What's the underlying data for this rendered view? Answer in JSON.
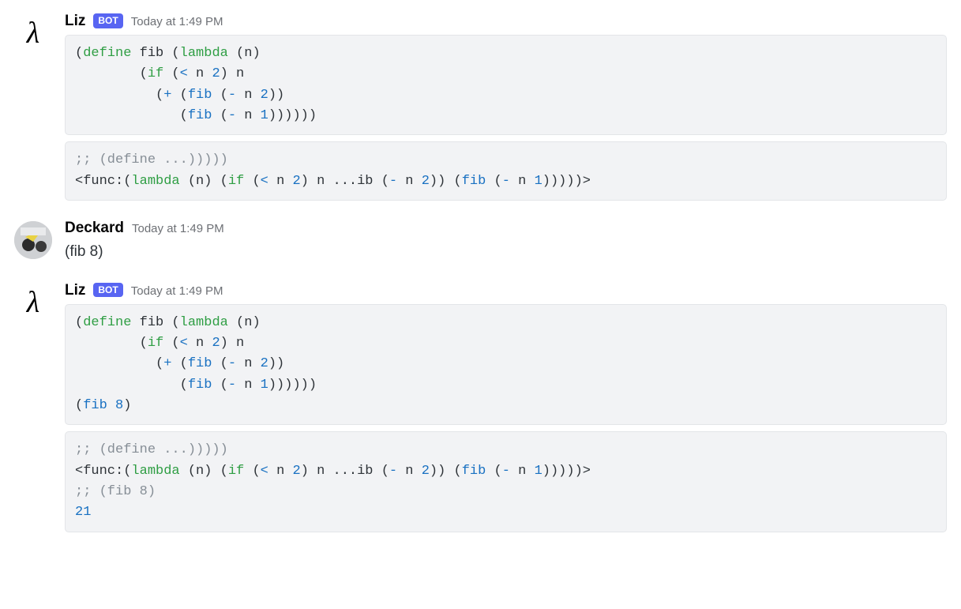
{
  "messages": [
    {
      "author": "Liz",
      "is_bot": true,
      "bot_label": "BOT",
      "timestamp": "Today at 1:49 PM",
      "avatar": {
        "type": "lambda",
        "glyph": "λ"
      },
      "blocks": [
        {
          "kind": "code",
          "lines": [
            [
              [
                "txt",
                "("
              ],
              [
                "kw",
                "define"
              ],
              [
                "txt",
                " fib ("
              ],
              [
                "kw",
                "lambda"
              ],
              [
                "txt",
                " (n)"
              ]
            ],
            [
              [
                "txt",
                "        ("
              ],
              [
                "kw",
                "if"
              ],
              [
                "txt",
                " ("
              ],
              [
                "fn",
                "<"
              ],
              [
                "txt",
                " n "
              ],
              [
                "num",
                "2"
              ],
              [
                "txt",
                ") n"
              ]
            ],
            [
              [
                "txt",
                "          ("
              ],
              [
                "fn",
                "+"
              ],
              [
                "txt",
                " ("
              ],
              [
                "fn",
                "fib"
              ],
              [
                "txt",
                " ("
              ],
              [
                "fn",
                "-"
              ],
              [
                "txt",
                " n "
              ],
              [
                "num",
                "2"
              ],
              [
                "txt",
                "))"
              ]
            ],
            [
              [
                "txt",
                "             ("
              ],
              [
                "fn",
                "fib"
              ],
              [
                "txt",
                " ("
              ],
              [
                "fn",
                "-"
              ],
              [
                "txt",
                " n "
              ],
              [
                "num",
                "1"
              ],
              [
                "txt",
                "))))))"
              ]
            ]
          ]
        },
        {
          "kind": "code",
          "lines": [
            [
              [
                "cm",
                ";; (define ...)))))"
              ]
            ],
            [
              [
                "txt",
                "<func:("
              ],
              [
                "kw",
                "lambda"
              ],
              [
                "txt",
                " (n) ("
              ],
              [
                "kw",
                "if"
              ],
              [
                "txt",
                " ("
              ],
              [
                "fn",
                "<"
              ],
              [
                "txt",
                " n "
              ],
              [
                "num",
                "2"
              ],
              [
                "txt",
                ") n ...ib ("
              ],
              [
                "fn",
                "-"
              ],
              [
                "txt",
                " n "
              ],
              [
                "num",
                "2"
              ],
              [
                "txt",
                ")) ("
              ],
              [
                "fn",
                "fib"
              ],
              [
                "txt",
                " ("
              ],
              [
                "fn",
                "-"
              ],
              [
                "txt",
                " n "
              ],
              [
                "num",
                "1"
              ],
              [
                "txt",
                ")))))>"
              ]
            ]
          ]
        }
      ]
    },
    {
      "author": "Deckard",
      "is_bot": false,
      "timestamp": "Today at 1:49 PM",
      "avatar": {
        "type": "user"
      },
      "blocks": [
        {
          "kind": "text",
          "text": "(fib 8)"
        }
      ]
    },
    {
      "author": "Liz",
      "is_bot": true,
      "bot_label": "BOT",
      "timestamp": "Today at 1:49 PM",
      "avatar": {
        "type": "lambda",
        "glyph": "λ"
      },
      "blocks": [
        {
          "kind": "code",
          "lines": [
            [
              [
                "txt",
                "("
              ],
              [
                "kw",
                "define"
              ],
              [
                "txt",
                " fib ("
              ],
              [
                "kw",
                "lambda"
              ],
              [
                "txt",
                " (n)"
              ]
            ],
            [
              [
                "txt",
                "        ("
              ],
              [
                "kw",
                "if"
              ],
              [
                "txt",
                " ("
              ],
              [
                "fn",
                "<"
              ],
              [
                "txt",
                " n "
              ],
              [
                "num",
                "2"
              ],
              [
                "txt",
                ") n"
              ]
            ],
            [
              [
                "txt",
                "          ("
              ],
              [
                "fn",
                "+"
              ],
              [
                "txt",
                " ("
              ],
              [
                "fn",
                "fib"
              ],
              [
                "txt",
                " ("
              ],
              [
                "fn",
                "-"
              ],
              [
                "txt",
                " n "
              ],
              [
                "num",
                "2"
              ],
              [
                "txt",
                "))"
              ]
            ],
            [
              [
                "txt",
                "             ("
              ],
              [
                "fn",
                "fib"
              ],
              [
                "txt",
                " ("
              ],
              [
                "fn",
                "-"
              ],
              [
                "txt",
                " n "
              ],
              [
                "num",
                "1"
              ],
              [
                "txt",
                "))))))"
              ]
            ],
            [
              [
                "txt",
                "("
              ],
              [
                "fn",
                "fib"
              ],
              [
                "txt",
                " "
              ],
              [
                "num",
                "8"
              ],
              [
                "txt",
                ")"
              ]
            ]
          ]
        },
        {
          "kind": "code",
          "lines": [
            [
              [
                "cm",
                ";; (define ...)))))"
              ]
            ],
            [
              [
                "txt",
                "<func:("
              ],
              [
                "kw",
                "lambda"
              ],
              [
                "txt",
                " (n) ("
              ],
              [
                "kw",
                "if"
              ],
              [
                "txt",
                " ("
              ],
              [
                "fn",
                "<"
              ],
              [
                "txt",
                " n "
              ],
              [
                "num",
                "2"
              ],
              [
                "txt",
                ") n ...ib ("
              ],
              [
                "fn",
                "-"
              ],
              [
                "txt",
                " n "
              ],
              [
                "num",
                "2"
              ],
              [
                "txt",
                ")) ("
              ],
              [
                "fn",
                "fib"
              ],
              [
                "txt",
                " ("
              ],
              [
                "fn",
                "-"
              ],
              [
                "txt",
                " n "
              ],
              [
                "num",
                "1"
              ],
              [
                "txt",
                ")))))>"
              ]
            ],
            [
              [
                "cm",
                ";; (fib 8)"
              ]
            ],
            [
              [
                "num",
                "21"
              ]
            ]
          ]
        }
      ]
    }
  ]
}
